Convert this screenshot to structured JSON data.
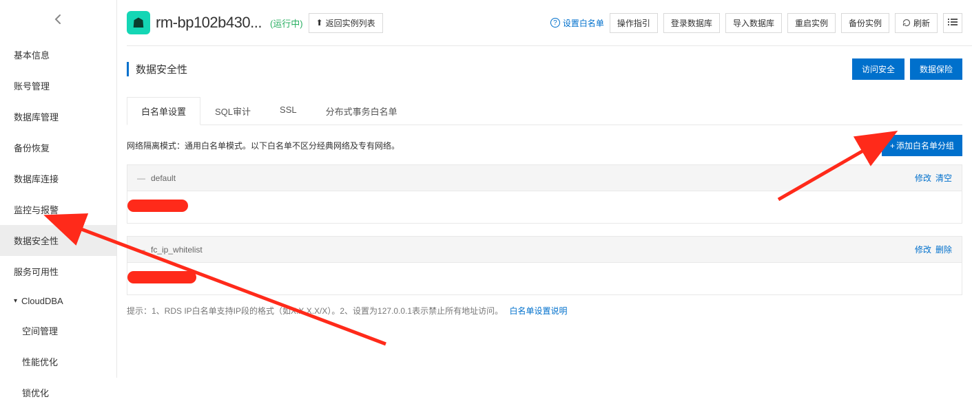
{
  "sidebar": {
    "items": [
      {
        "label": "基本信息",
        "key": "basic-info"
      },
      {
        "label": "账号管理",
        "key": "account-mgmt"
      },
      {
        "label": "数据库管理",
        "key": "database-mgmt"
      },
      {
        "label": "备份恢复",
        "key": "backup-restore"
      },
      {
        "label": "数据库连接",
        "key": "db-connection"
      },
      {
        "label": "监控与报警",
        "key": "monitor-alarm"
      },
      {
        "label": "数据安全性",
        "key": "data-security",
        "active": true
      },
      {
        "label": "服务可用性",
        "key": "service-availability"
      }
    ],
    "group": {
      "label": "CloudDBA",
      "children": [
        {
          "label": "空间管理",
          "key": "space-mgmt"
        },
        {
          "label": "性能优化",
          "key": "perf-opt"
        },
        {
          "label": "锁优化",
          "key": "lock-opt"
        }
      ]
    }
  },
  "header": {
    "instance_name": "rm-bp102b430...",
    "status": "(运行中)",
    "back_label": "返回实例列表",
    "set_whitelist": "设置白名单",
    "buttons": {
      "guide": "操作指引",
      "login_db": "登录数据库",
      "import_db": "导入数据库",
      "restart": "重启实例",
      "backup": "备份实例",
      "refresh": "刷新"
    }
  },
  "section": {
    "title": "数据安全性",
    "buttons": {
      "access_security": "访问安全",
      "data_insurance": "数据保险"
    }
  },
  "tabs": [
    {
      "label": "白名单设置",
      "active": true
    },
    {
      "label": "SQL审计"
    },
    {
      "label": "SSL"
    },
    {
      "label": "分布式事务白名单"
    }
  ],
  "whitelist": {
    "mode_text": "网络隔离模式：通用白名单模式。以下白名单不区分经典网络及专有网络。",
    "add_group": "添加白名单分组",
    "groups": [
      {
        "name": "default",
        "actions": [
          "修改",
          "清空"
        ]
      },
      {
        "name": "fc_ip_whitelist",
        "actions": [
          "修改",
          "删除"
        ]
      }
    ],
    "hint_prefix": "提示：1、RDS IP白名单支持IP段的格式（如X.X.X.X/X）。2、设置为127.0.0.1表示禁止所有地址访问。",
    "hint_link": "白名单设置说明"
  }
}
